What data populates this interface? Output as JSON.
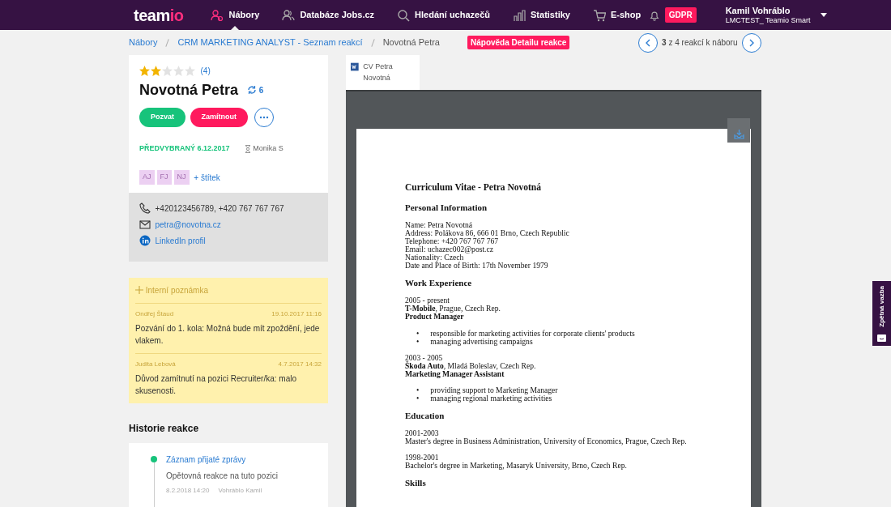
{
  "nav": {
    "logo": "team",
    "logo_accent": "io",
    "items": [
      {
        "label": "Nábory",
        "selected": true
      },
      {
        "label": "Databáze Jobs.cz",
        "selected": false
      },
      {
        "label": "Hledání uchazečů",
        "selected": false
      },
      {
        "label": "Statistiky",
        "selected": false
      },
      {
        "label": "E-shop",
        "selected": false
      }
    ],
    "gdpr": "GDPR",
    "user": {
      "name": "Kamil Vohráblo",
      "account": "LMCTEST_ Teamio Smart"
    }
  },
  "breadcrumb": [
    "Nábory",
    "CRM MARKETING ANALYST - Seznam reakcí",
    "Novotná Petra"
  ],
  "help_badge": "Nápověda Detailu reakce",
  "pager": {
    "current": "3",
    "text": "z 4 reakcí k náboru"
  },
  "candidate": {
    "stars": 2,
    "rating_count": "(4)",
    "name": "Novotná Petra",
    "reactions": "6",
    "buttons": [
      "Pozvat",
      "Zamítnout"
    ],
    "status": "PŘEDVYBRANÝ 6.12.2017",
    "owner": "Monika S",
    "tags": [
      "AJ",
      "FJ",
      "NJ"
    ],
    "add_tag": "+ štítek"
  },
  "contact": {
    "phone": "+420123456789, +420 767 767 767",
    "email": "petra@novotna.cz",
    "linkedin": "LinkedIn profil"
  },
  "notes": {
    "add_label": "Interní poznámka",
    "items": [
      {
        "author": "Ondřej Štaud",
        "date": "19.10.2017 11:16",
        "text": "Pozvání do 1. kola: Možná bude mít zpoždění, jede vlakem."
      },
      {
        "author": "Judita Lebová",
        "date": "4.7.2017 14:32",
        "text": "Důvod zamítnutí na pozici Recruiter/ka: malo skusenosti."
      }
    ]
  },
  "history": {
    "title": "Historie reakce",
    "items": [
      {
        "title": "Záznam přijaté zprávy",
        "text": "Opětovná reakce na tuto pozici",
        "date": "8.2.2018 14:20",
        "author": "Vohráblo Kamil"
      }
    ]
  },
  "document": {
    "tab": "CV Petra Novotná",
    "blocks": [
      {
        "kind": "title",
        "text": "Curriculum Vitae - Petra Novotná"
      },
      {
        "kind": "heading",
        "text": "Personal Information"
      },
      {
        "kind": "lines",
        "lines": [
          "Name: Petra Novotná",
          "Address: Polákova 86, 666 01 Brno, Czech Republic",
          "Telephone: +420 767 767 767",
          "Email: uchazec002@post.cz",
          "Nationality: Czech",
          "Date and Place of Birth: 17th November 1979"
        ]
      },
      {
        "kind": "heading",
        "text": "Work Experience"
      },
      {
        "kind": "lines",
        "lines": [
          "2005 - present",
          "**T-Mobile**, Prague, Czech Rep.",
          "**Product Manager**"
        ]
      },
      {
        "kind": "bullets",
        "marker": "•",
        "lines": [
          "responsible for marketing activities for corporate clients' products",
          "managing advertising campaigns"
        ]
      },
      {
        "kind": "lines",
        "lines": [
          "2003 - 2005",
          "**Škoda Auto**, Mladá Boleslav, Czech Rep.",
          "**Marketing Manager Assistant**"
        ]
      },
      {
        "kind": "bullets",
        "marker": "•",
        "lines": [
          "providing support to Marketing Manager",
          "managing regional marketing activities"
        ]
      },
      {
        "kind": "heading",
        "text": "Education"
      },
      {
        "kind": "lines",
        "lines": [
          "2001-2003",
          "Master's degree in Business Administration, University of Economics, Prague, Czech Rep."
        ]
      },
      {
        "kind": "lines",
        "lines": [
          "1998-2001",
          "Bachelor's degree in Marketing, Masaryk University, Brno, Czech Rep."
        ]
      },
      {
        "kind": "heading",
        "text": "Skills"
      }
    ]
  },
  "feedback": "Zpětná vazba"
}
